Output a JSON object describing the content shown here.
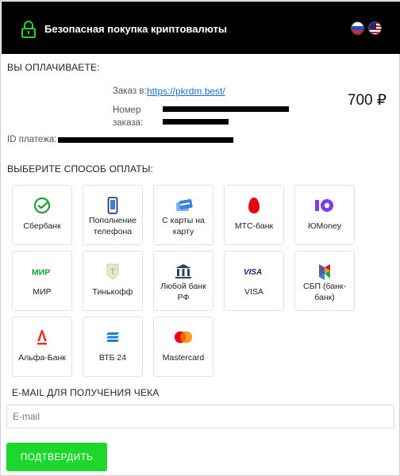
{
  "header": {
    "title": "Безопасная покупка криптовалюты",
    "lock_icon": "lock-icon",
    "languages": [
      "ru-flag-icon",
      "us-flag-icon"
    ]
  },
  "payment": {
    "section_label": "ВЫ ОПЛАЧИВАЕТЕ:",
    "order_label": "Заказ в:",
    "order_link": "https://pkrdm.best/",
    "order_number_label": "Номер заказа:",
    "amount": "700 ₽",
    "payment_id_label": "ID платежа:"
  },
  "methods": {
    "section_label": "ВЫБЕРИТЕ СПОСОБ ОПЛАТЫ:",
    "items": [
      {
        "label": "Сбербанк",
        "icon": "sberbank-icon"
      },
      {
        "label": "Пополнение телефона",
        "icon": "phone-icon"
      },
      {
        "label": "С карты на карту",
        "icon": "card-transfer-icon"
      },
      {
        "label": "МТС-банк",
        "icon": "mts-egg-icon"
      },
      {
        "label": "ЮMoney",
        "icon": "yoomoney-icon"
      },
      {
        "label": "МИР",
        "icon": "mir-icon"
      },
      {
        "label": "Тинькофф",
        "icon": "tinkoff-icon"
      },
      {
        "label": "Любой банк РФ",
        "icon": "bank-building-icon"
      },
      {
        "label": "VISA",
        "icon": "visa-icon"
      },
      {
        "label": "СБП (банк-банк)",
        "icon": "sbp-icon"
      },
      {
        "label": "Альфа-Банк",
        "icon": "alfa-bank-icon"
      },
      {
        "label": "ВТБ 24",
        "icon": "vtb-icon"
      },
      {
        "label": "Mastercard",
        "icon": "mastercard-icon"
      }
    ]
  },
  "email": {
    "section_label": "E-MAIL ДЛЯ ПОЛУЧЕНИЯ ЧЕКА",
    "placeholder": "E-mail",
    "value": ""
  },
  "confirm": {
    "label": "ПОДТВЕРДИТЬ"
  },
  "colors": {
    "header_bg": "#000000",
    "accent_green": "#1ed72d",
    "link": "#1a6fc9"
  }
}
